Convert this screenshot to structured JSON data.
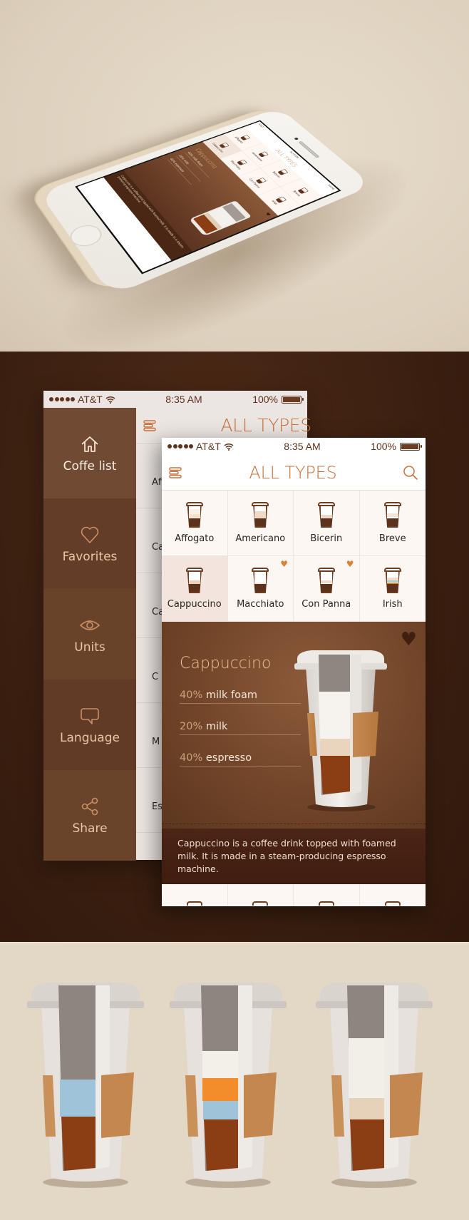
{
  "status_bar": {
    "carrier": "AT&T",
    "time": "8:35 AM",
    "battery": "100%",
    "signal_bars": 5
  },
  "nav": {
    "title": "ALL TYPES",
    "menu_icon": "hamburger-icon",
    "search_icon": "search-icon"
  },
  "sidebar": {
    "items": [
      {
        "label": "Coffe list",
        "icon": "home-icon",
        "active": true
      },
      {
        "label": "Favorites",
        "icon": "heart-icon",
        "active": false
      },
      {
        "label": "Units",
        "icon": "eye-icon",
        "active": false
      },
      {
        "label": "Language",
        "icon": "speech-bubble-icon",
        "active": false
      },
      {
        "label": "Share",
        "icon": "share-icon",
        "active": false
      }
    ]
  },
  "background_list": {
    "rows": [
      "Aff",
      "Capp",
      "Caff",
      "C",
      "M",
      "Esp"
    ]
  },
  "coffee_grid": {
    "items": [
      {
        "name": "Affogato",
        "favorite": false,
        "selected": false
      },
      {
        "name": "Americano",
        "favorite": false,
        "selected": false
      },
      {
        "name": "Bicerin",
        "favorite": false,
        "selected": false
      },
      {
        "name": "Breve",
        "favorite": false,
        "selected": false
      },
      {
        "name": "Cappuccino",
        "favorite": false,
        "selected": true
      },
      {
        "name": "Macchiato",
        "favorite": true,
        "selected": false
      },
      {
        "name": "Con Panna",
        "favorite": true,
        "selected": false
      },
      {
        "name": "Irish",
        "favorite": false,
        "selected": false
      }
    ]
  },
  "detail": {
    "title": "Cappuccino",
    "ingredients": [
      {
        "percent": "40%",
        "name": "milk foam"
      },
      {
        "percent": "20%",
        "name": "milk"
      },
      {
        "percent": "40%",
        "name": "espresso"
      }
    ],
    "description": "Cappuccino is a coffee drink topped with foamed milk. It is made in a steam-producing espresso machine.",
    "favorite_icon": "heart-icon"
  },
  "mockup_3d": {
    "title": "ALL TYPES",
    "time": "8:35 AM",
    "carrier": "AT&T",
    "battery": "100%",
    "grid": [
      "Affogato",
      "Americano",
      "Bicerin",
      "Breve",
      "Cappuccino",
      "Macchiato",
      "Con Panna",
      "Irish"
    ],
    "detail_title": "Cappuccino",
    "ingredients": [
      "40% milk foam",
      "20% milk",
      "40% espresso"
    ],
    "description": "Cappuccino is a coffee drink topped with foamed milk. It is made in a steam-producing espresso machine."
  },
  "colors": {
    "accent": "#c8703c",
    "sidebar": "#714a33",
    "dark_bg": "#3f2212",
    "light_bg": "#e3d7c6",
    "favorite": "#d8843a",
    "espresso": "#8b3d14"
  },
  "illustrations": [
    {
      "name": "cup-water-espresso",
      "layers": [
        "water",
        "espresso"
      ]
    },
    {
      "name": "cup-foam-orange-water-espresso",
      "layers": [
        "milk foam",
        "orange",
        "water",
        "espresso"
      ]
    },
    {
      "name": "cup-foam-milk-espresso",
      "layers": [
        "milk foam",
        "milk",
        "espresso"
      ]
    }
  ]
}
